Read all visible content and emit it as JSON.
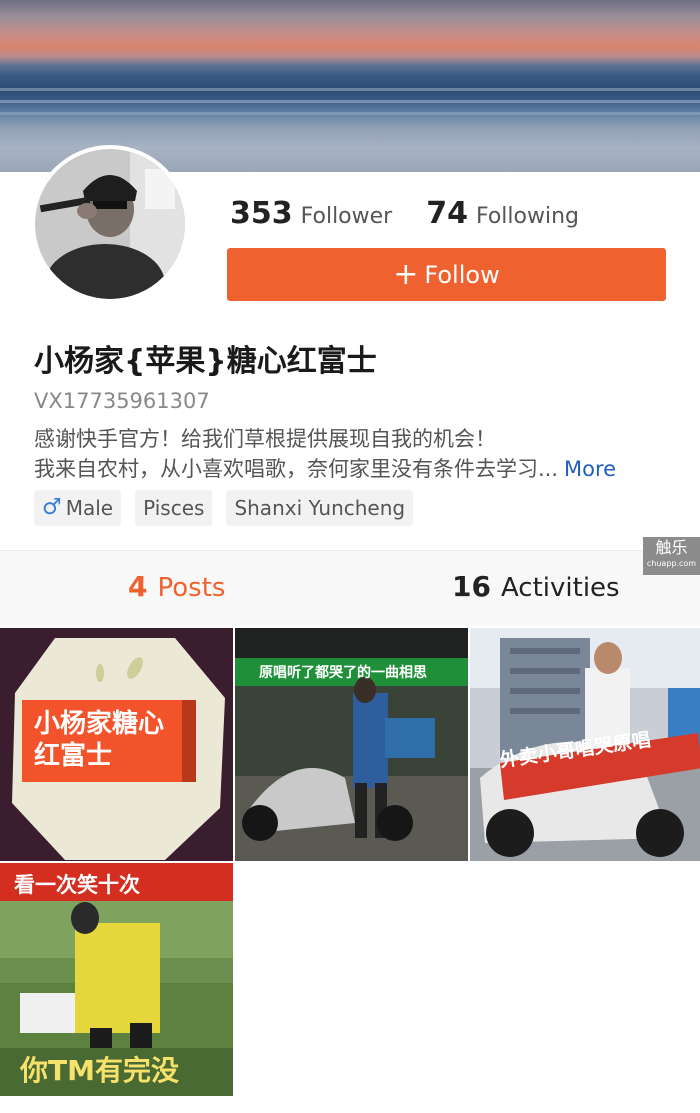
{
  "profile": {
    "followers_count": "353",
    "followers_label": "Follower",
    "following_count": "74",
    "following_label": "Following",
    "follow_button": "Follow",
    "username": "小杨家{苹果}糖心红富士",
    "wechat": "VX17735961307",
    "bio_line1": "感谢快手官方！给我们草根提供展现自我的机会！",
    "bio_line2": "我来自农村，从小喜欢唱歌，奈何家里没有条件去学习...",
    "more_label": "More",
    "tags": {
      "gender": "Male",
      "zodiac": "Pisces",
      "location": "Shanxi Yuncheng"
    }
  },
  "tabs": {
    "posts_count": "4",
    "posts_label": "Posts",
    "activities_count": "16",
    "activities_label": "Activities"
  },
  "watermark": {
    "title": "触乐",
    "sub": "chuapp.com"
  },
  "posts": [
    {
      "caption_line1": "小杨家糖心",
      "caption_line2": "红富士"
    },
    {
      "caption": "原唱听了都哭了的一曲相思"
    },
    {
      "caption": "外卖小哥唱哭原唱"
    },
    {
      "caption_top": "看一次笑十次",
      "caption_bottom": "你TM有完没"
    }
  ],
  "colors": {
    "accent": "#ef6230",
    "link": "#1f5fbf",
    "male": "#3a7fd5"
  }
}
